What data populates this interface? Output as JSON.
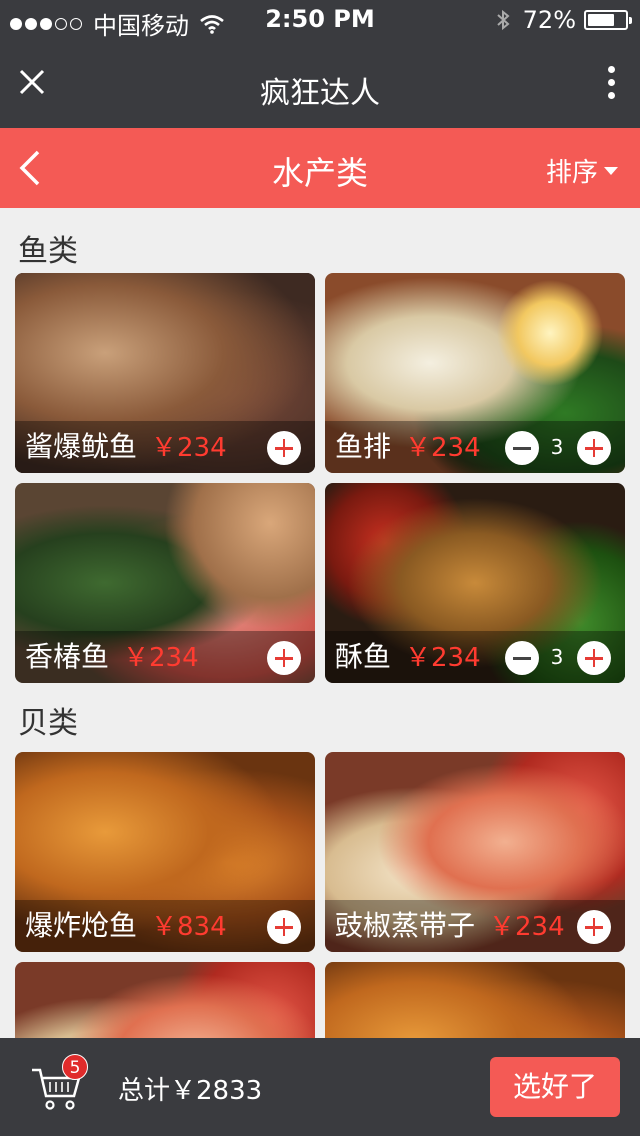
{
  "status": {
    "carrier": "中国移动",
    "time": "2:50 PM",
    "battery": "72%",
    "battery_level": 0.72,
    "signal_dots": 3
  },
  "titlebar": {
    "title": "疯狂达人",
    "close_icon": "close-icon",
    "more_icon": "more-vertical-icon"
  },
  "nav": {
    "title": "水产类",
    "sort_label": "排序",
    "back_icon": "chevron-left-icon"
  },
  "sections": [
    {
      "title": "鱼类",
      "items": [
        {
          "name": "酱爆鱿鱼",
          "price": "￥234",
          "qty": null
        },
        {
          "name": "鱼排",
          "price": "￥234",
          "qty": "3"
        },
        {
          "name": "香椿鱼",
          "price": "￥234",
          "qty": null
        },
        {
          "name": "酥鱼",
          "price": "￥234",
          "qty": "3"
        }
      ]
    },
    {
      "title": "贝类",
      "items": [
        {
          "name": "爆炸炝鱼",
          "price": "￥834",
          "qty": null
        },
        {
          "name": "豉椒蒸带子",
          "price": "￥234",
          "qty": null
        }
      ]
    }
  ],
  "cart": {
    "badge": "5",
    "total": "总计￥2833",
    "confirm": "选好了",
    "icon": "cart-icon"
  },
  "colors": {
    "accent": "#f45a55",
    "dark": "#3a3b3f",
    "price": "#ff3b30"
  }
}
